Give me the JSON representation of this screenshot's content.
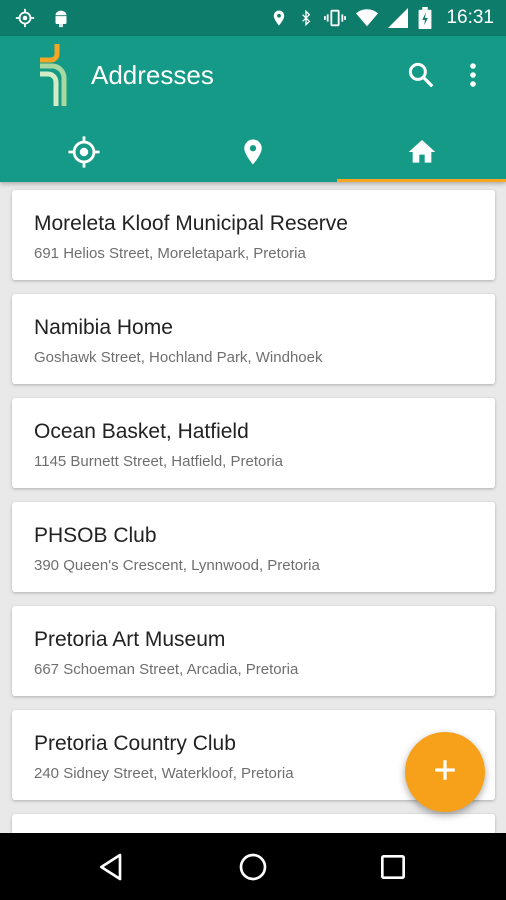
{
  "status_bar": {
    "time": "16:31",
    "icons": [
      "gps-icon",
      "android-icon",
      "location-icon",
      "bluetooth-icon",
      "vibrate-icon",
      "wifi-icon",
      "signal-icon",
      "battery-icon"
    ]
  },
  "app_bar": {
    "title": "Addresses",
    "actions": [
      "search-icon",
      "more-vert-icon"
    ],
    "color": "#149a86",
    "status_color": "#0e7c6b"
  },
  "tabs": [
    {
      "icon": "my-location-icon",
      "active": false
    },
    {
      "icon": "place-icon",
      "active": false
    },
    {
      "icon": "home-icon",
      "active": true
    }
  ],
  "addresses": [
    {
      "name": "Moreleta Kloof Municipal Reserve",
      "address": "691 Helios Street, Moreletapark, Pretoria"
    },
    {
      "name": "Namibia Home",
      "address": "Goshawk Street, Hochland Park, Windhoek"
    },
    {
      "name": "Ocean Basket, Hatfield",
      "address": "1145 Burnett Street, Hatfield, Pretoria"
    },
    {
      "name": "PHSOB Club",
      "address": "390 Queen's Crescent, Lynnwood, Pretoria"
    },
    {
      "name": "Pretoria Art Museum",
      "address": "667 Schoeman Street, Arcadia, Pretoria"
    },
    {
      "name": "Pretoria Country Club",
      "address": "240 Sidney Street, Waterkloof, Pretoria"
    }
  ],
  "fab": {
    "icon": "add-icon",
    "color": "#f7a11a"
  },
  "nav_bar": {
    "icons": [
      "back-icon",
      "home-circle-icon",
      "recents-icon"
    ]
  }
}
